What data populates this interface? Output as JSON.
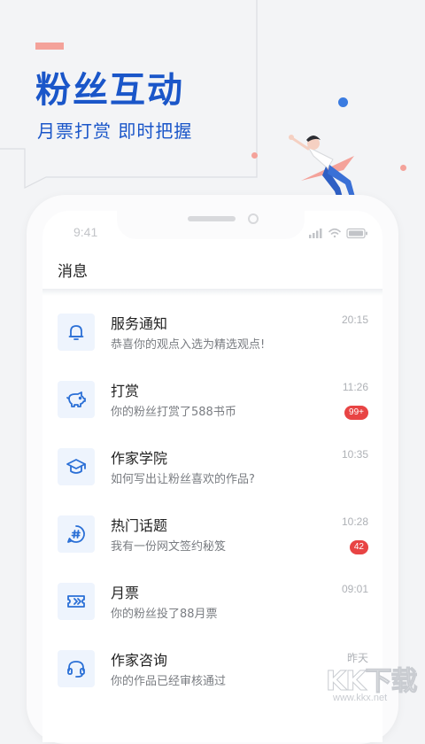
{
  "promo": {
    "headline": "粉丝互动",
    "subhead": "月票打赏 即时把握"
  },
  "phone": {
    "status_time": "9:41"
  },
  "page": {
    "title": "消息"
  },
  "messages": [
    {
      "title": "服务通知",
      "subtitle": "恭喜你的观点入选为精选观点!",
      "time": "20:15",
      "badge": "",
      "icon": "bell-icon"
    },
    {
      "title": "打赏",
      "subtitle": "你的粉丝打赏了588书币",
      "time": "11:26",
      "badge": "99+",
      "icon": "piggy-bank-icon"
    },
    {
      "title": "作家学院",
      "subtitle": "如何写出让粉丝喜欢的作品?",
      "time": "10:35",
      "badge": "",
      "icon": "graduation-cap-icon"
    },
    {
      "title": "热门话题",
      "subtitle": "我有一份网文签约秘笈",
      "time": "10:28",
      "badge": "42",
      "icon": "hashtag-icon"
    },
    {
      "title": "月票",
      "subtitle": "你的粉丝投了88月票",
      "time": "09:01",
      "badge": "",
      "icon": "ticket-icon"
    },
    {
      "title": "作家咨询",
      "subtitle": "你的作品已经审核通过",
      "time": "昨天",
      "badge": "",
      "icon": "headset-icon"
    }
  ],
  "watermark": {
    "text": "KK下载",
    "url": "www.kkx.net"
  },
  "colors": {
    "brand_blue": "#1a56c9",
    "icon_blue": "#2a6fd6",
    "badge_red": "#e84444",
    "accent_pink": "#f4a29a"
  }
}
